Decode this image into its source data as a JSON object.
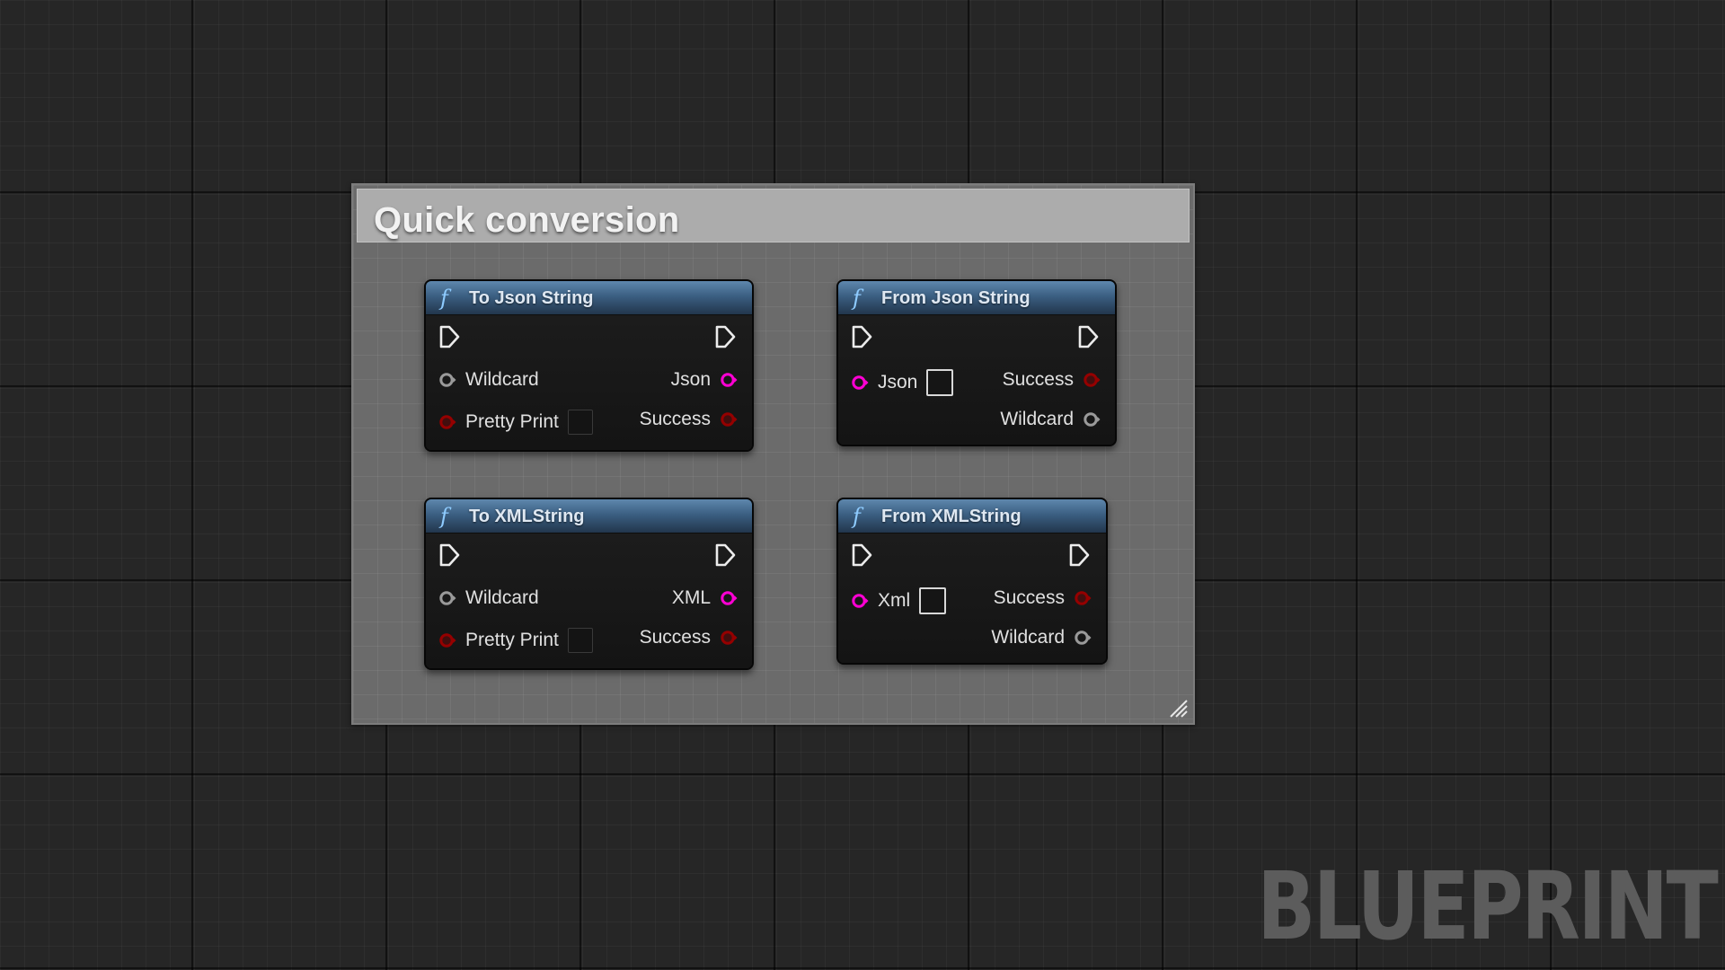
{
  "comment": {
    "title": "Quick conversion"
  },
  "nodes": [
    {
      "title": "To Json String",
      "icon": "function-icon",
      "inputs": [
        {
          "label": "Wildcard",
          "type": "wildcard",
          "color": "#9a9a9a"
        },
        {
          "label": "Pretty Print",
          "type": "boolean",
          "color": "#950000"
        }
      ],
      "outputs": [
        {
          "label": "Json",
          "type": "string",
          "color": "#ff00d4"
        },
        {
          "label": "Success",
          "type": "boolean",
          "color": "#950000"
        }
      ]
    },
    {
      "title": "From Json String",
      "icon": "function-icon",
      "inputs": [
        {
          "label": "Json",
          "type": "string",
          "color": "#ff00d4"
        }
      ],
      "outputs": [
        {
          "label": "Success",
          "type": "boolean",
          "color": "#950000"
        },
        {
          "label": "Wildcard",
          "type": "wildcard",
          "color": "#9a9a9a"
        }
      ]
    },
    {
      "title": "To XMLString",
      "icon": "function-icon",
      "inputs": [
        {
          "label": "Wildcard",
          "type": "wildcard",
          "color": "#9a9a9a"
        },
        {
          "label": "Pretty Print",
          "type": "boolean",
          "color": "#950000"
        }
      ],
      "outputs": [
        {
          "label": "XML",
          "type": "string",
          "color": "#ff00d4"
        },
        {
          "label": "Success",
          "type": "boolean",
          "color": "#950000"
        }
      ]
    },
    {
      "title": "From XMLString",
      "icon": "function-icon",
      "inputs": [
        {
          "label": "Xml",
          "type": "string",
          "color": "#ff00d4"
        }
      ],
      "outputs": [
        {
          "label": "Success",
          "type": "boolean",
          "color": "#950000"
        },
        {
          "label": "Wildcard",
          "type": "wildcard",
          "color": "#9a9a9a"
        }
      ]
    }
  ],
  "watermark": "BLUEPRINT"
}
